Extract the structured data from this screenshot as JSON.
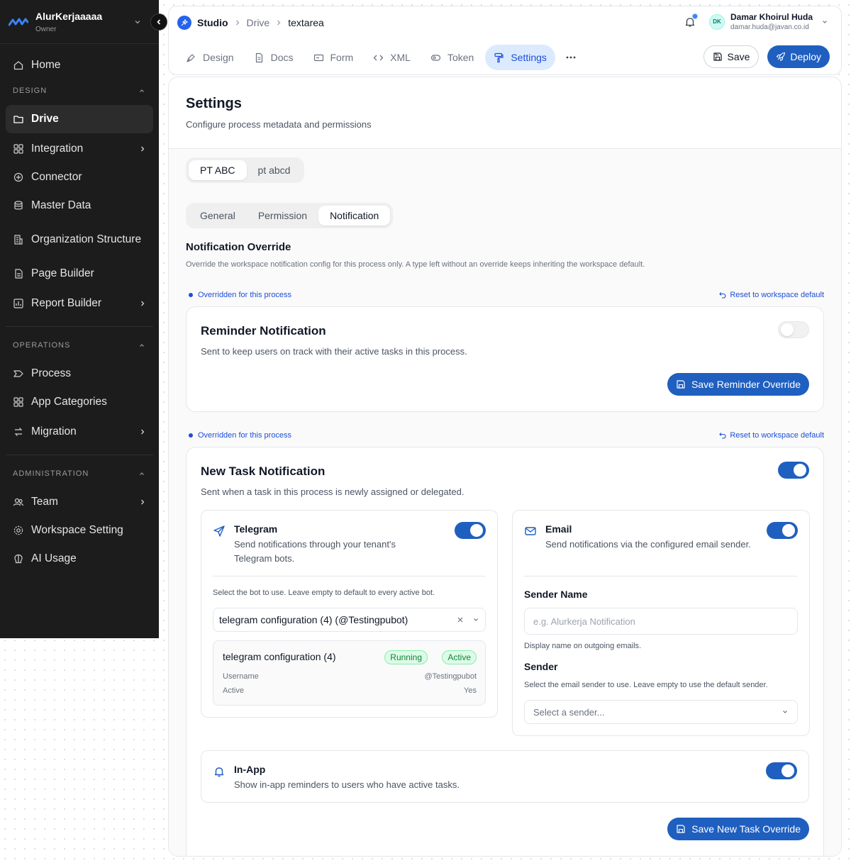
{
  "workspace": {
    "name": "AlurKerjaaaaa",
    "role": "Owner"
  },
  "sidebar": {
    "home": "Home",
    "design_section": "DESIGN",
    "design_items": [
      "Drive",
      "Integration",
      "Connector",
      "Master Data",
      "Organization Structure",
      "Page Builder",
      "Report Builder"
    ],
    "operations_section": "OPERATIONS",
    "operations_items": [
      "Process",
      "App Categories",
      "Migration"
    ],
    "administration_section": "ADMINISTRATION",
    "administration_items": [
      "Team",
      "Workspace Setting",
      "AI Usage"
    ],
    "active_item": "Drive"
  },
  "breadcrumb": {
    "root": "Studio",
    "parent": "Drive",
    "current": "textarea"
  },
  "user": {
    "initials": "DK",
    "name": "Damar Khoirul Huda",
    "email": "damar.huda@javan.co.id"
  },
  "tabs": [
    "Design",
    "Docs",
    "Form",
    "XML",
    "Token",
    "Settings"
  ],
  "active_tab": "Settings",
  "actions": {
    "save": "Save",
    "deploy": "Deploy"
  },
  "settings": {
    "title": "Settings",
    "subtitle": "Configure process metadata and permissions",
    "companies": [
      "PT ABC",
      "pt abcd"
    ],
    "active_company": "PT ABC",
    "subtabs": [
      "General",
      "Permission",
      "Notification"
    ],
    "active_subtab": "Notification"
  },
  "notification": {
    "title": "Notification Override",
    "description": "Override the workspace notification config for this process only. A type left without an override keeps inheriting the workspace default.",
    "overridden_label": "Overridden for this process",
    "reset_label": "Reset to workspace default",
    "reminder": {
      "title": "Reminder Notification",
      "description": "Sent to keep users on track with their active tasks in this process.",
      "enabled": false,
      "save_label": "Save Reminder Override"
    },
    "new_task": {
      "title": "New Task Notification",
      "description": "Sent when a task in this process is newly assigned or delegated.",
      "enabled": true,
      "save_label": "Save New Task Override",
      "telegram": {
        "title": "Telegram",
        "description": "Send notifications through your tenant's Telegram bots.",
        "enabled": true,
        "hint": "Select the bot to use. Leave empty to default to every active bot.",
        "selected_bot": "telegram configuration (4) (@Testingpubot)",
        "bot_name": "telegram configuration (4)",
        "badge_running": "Running",
        "badge_active": "Active",
        "username_label": "Username",
        "username_value": "@Testingpubot",
        "active_label": "Active",
        "active_value": "Yes"
      },
      "email": {
        "title": "Email",
        "description": "Send notifications via the configured email sender.",
        "enabled": true,
        "sender_name_label": "Sender Name",
        "sender_name_placeholder": "e.g. Alurkerja Notification",
        "sender_name_hint": "Display name on outgoing emails.",
        "sender_label": "Sender",
        "sender_hint": "Select the email sender to use. Leave empty to use the default sender.",
        "sender_placeholder": "Select a sender..."
      },
      "in_app": {
        "title": "In-App",
        "description": "Show in-app reminders to users who have active tasks.",
        "enabled": true
      }
    }
  },
  "colors": {
    "primary": "#1f5fbf",
    "sidebar_bg": "#1c1c1c",
    "success": "#15803d",
    "accent_light": "#dbeafe"
  }
}
